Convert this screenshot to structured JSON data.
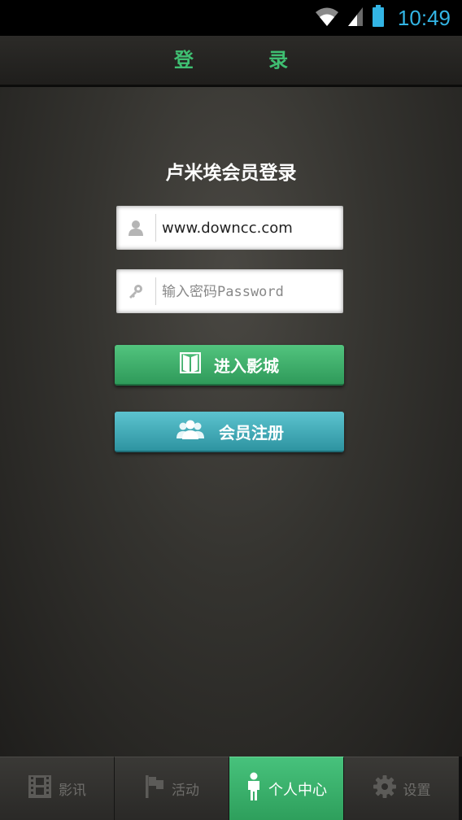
{
  "status_bar": {
    "time": "10:49",
    "icons": [
      "wifi-icon",
      "signal-icon",
      "battery-icon"
    ],
    "accent_color": "#33b5e5"
  },
  "header": {
    "title": "登 录",
    "title_color": "#3fbf72"
  },
  "login": {
    "heading": "卢米埃会员登录",
    "username": {
      "value": "www.downcc.com",
      "icon": "user-icon"
    },
    "password": {
      "placeholder": "输入密码Password",
      "icon": "key-icon"
    },
    "enter_button": {
      "label": "进入影城",
      "icon": "door-icon",
      "color": "#3fae6a"
    },
    "register_button": {
      "label": "会员注册",
      "icon": "users-icon",
      "color": "#3fa9b5"
    }
  },
  "tabs": [
    {
      "label": "影讯",
      "icon": "film-icon",
      "active": false
    },
    {
      "label": "活动",
      "icon": "flag-icon",
      "active": false
    },
    {
      "label": "个人中心",
      "icon": "person-icon",
      "active": true
    },
    {
      "label": "设置",
      "icon": "gear-icon",
      "active": false
    }
  ]
}
